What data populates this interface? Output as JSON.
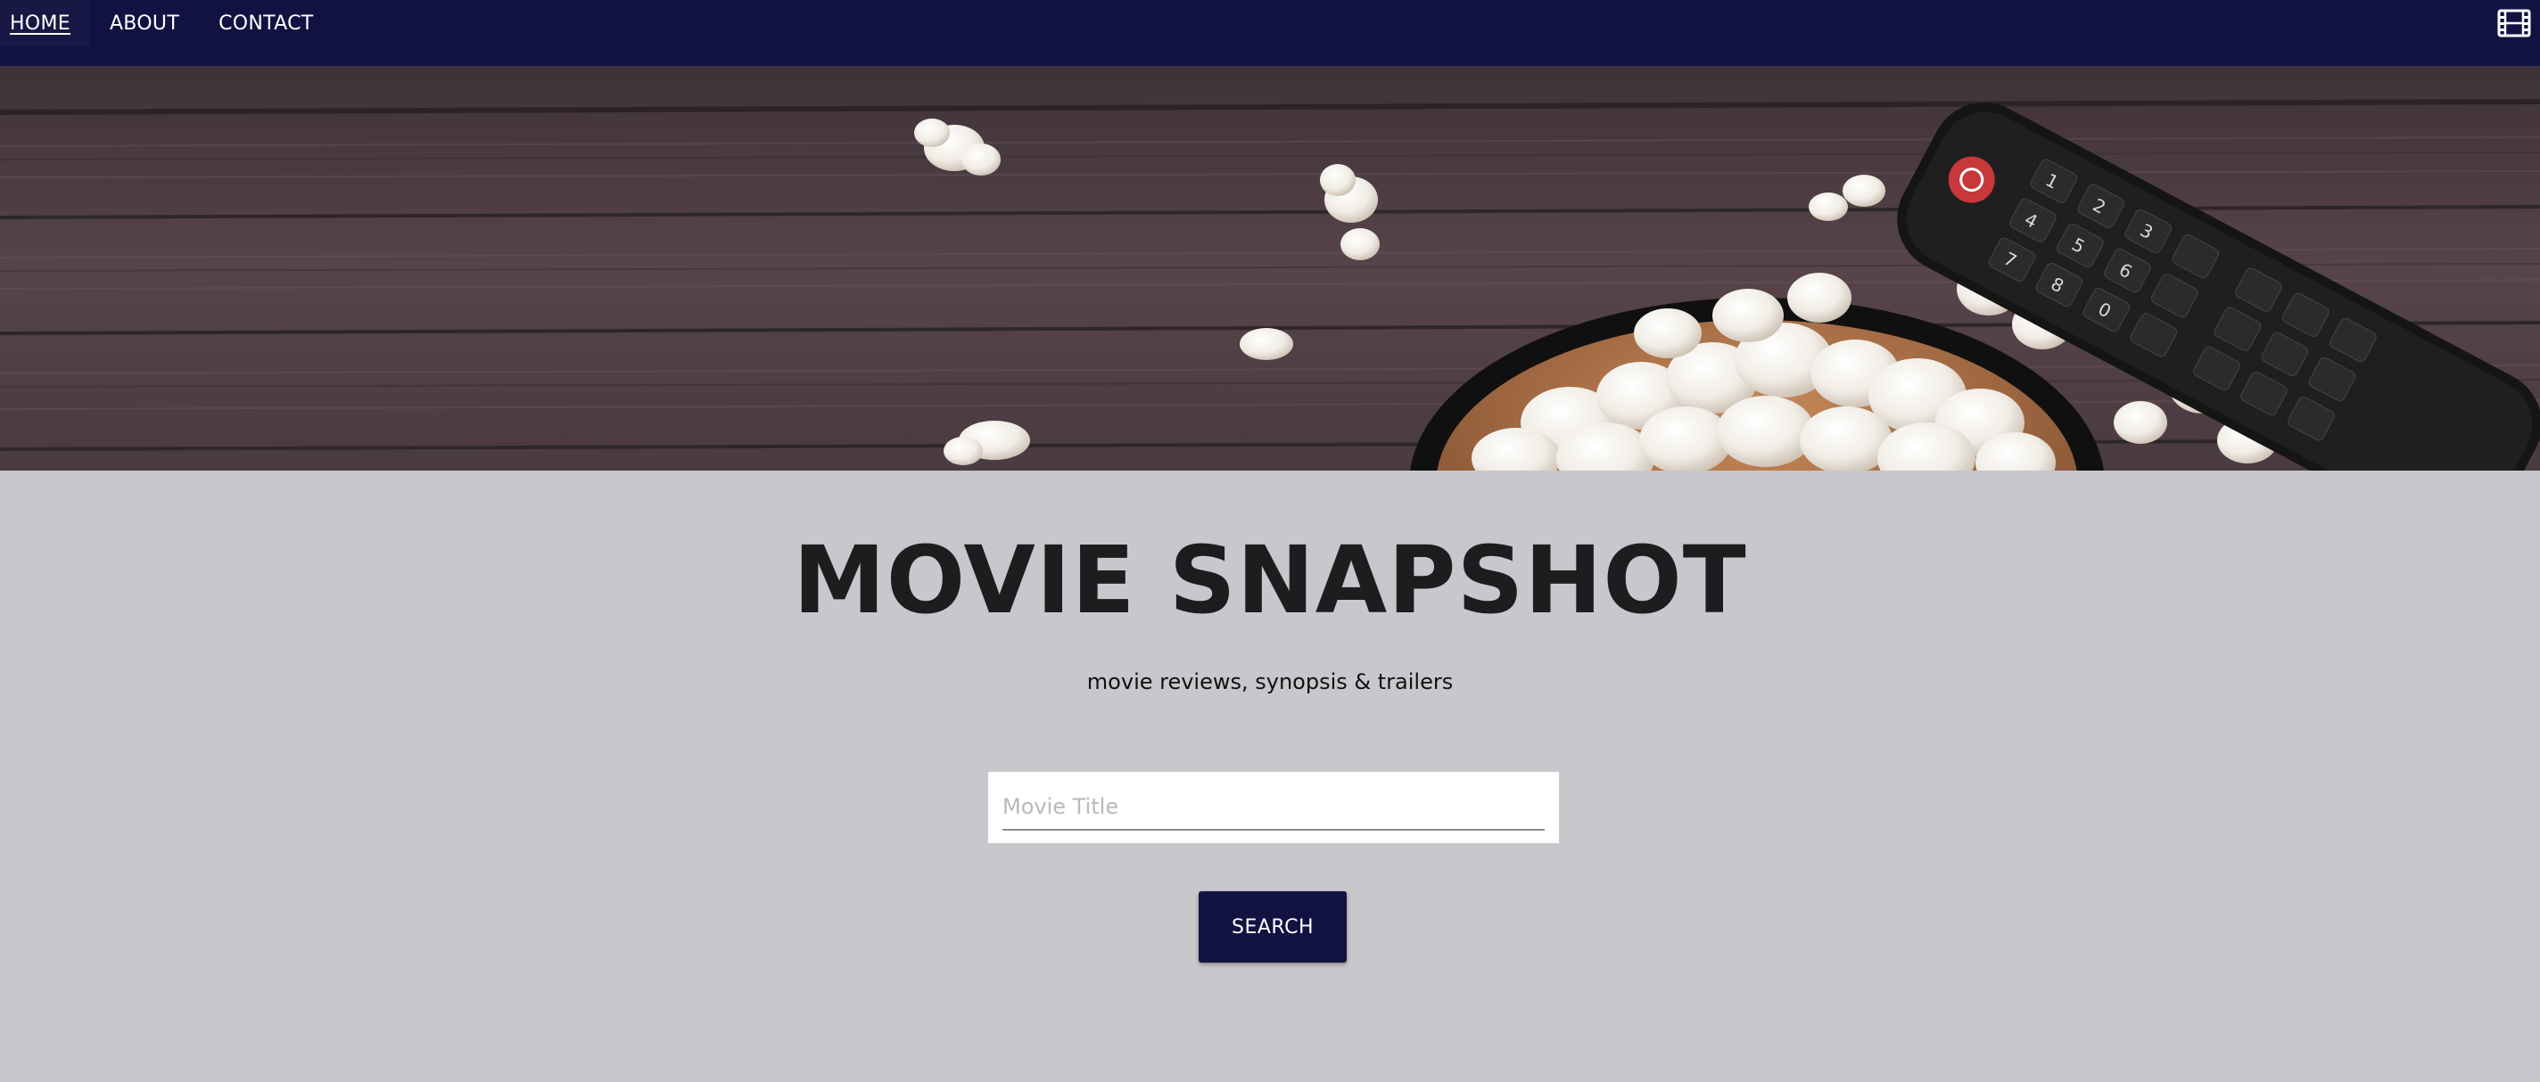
{
  "nav": {
    "links": [
      {
        "label": "HOME",
        "active": true
      },
      {
        "label": "ABOUT",
        "active": false
      },
      {
        "label": "CONTACT",
        "active": false
      }
    ],
    "icon": "film-icon"
  },
  "hero": {
    "image": "hero-popcorn-image"
  },
  "main": {
    "title": "MOVIE SNAPSHOT",
    "tagline": "movie reviews, synopsis & trailers",
    "search": {
      "placeholder": "Movie Title",
      "value": "",
      "button_label": "SEARCH"
    }
  },
  "colors": {
    "navbar": "#121242",
    "page_background": "#c8c7cb",
    "button": "#121242",
    "title_text": "#1d1d1f"
  }
}
